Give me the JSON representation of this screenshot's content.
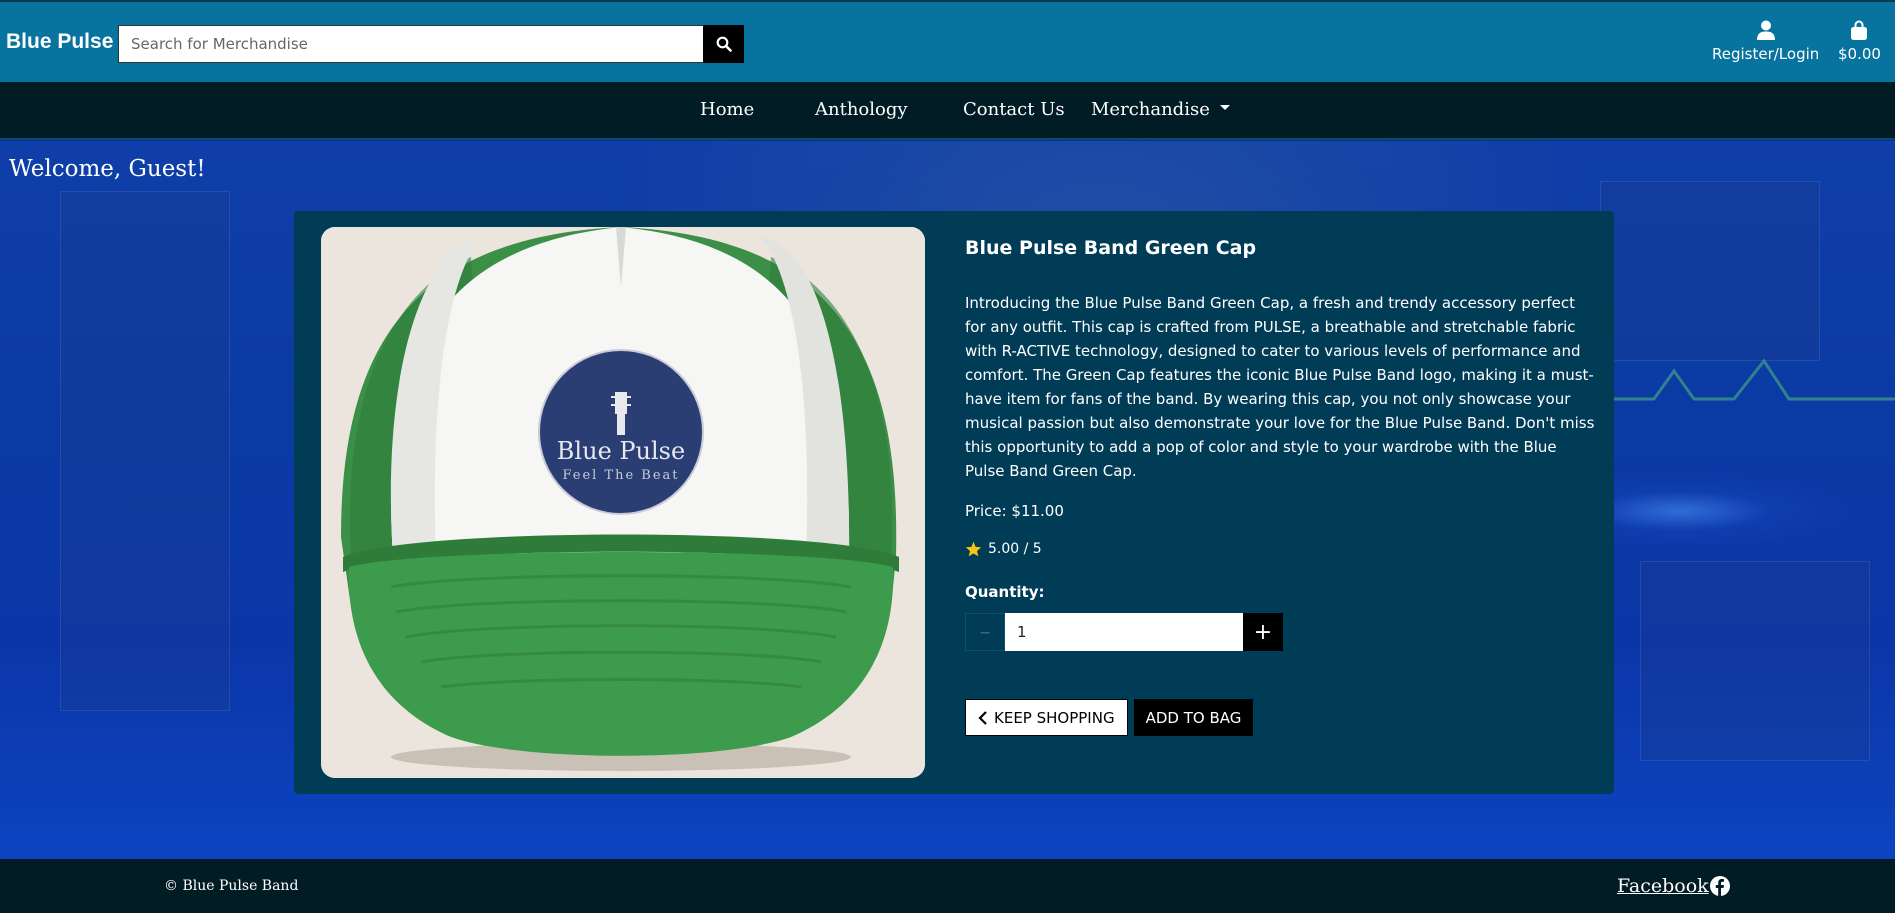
{
  "header": {
    "brand": "Blue Pulse",
    "search": {
      "placeholder": "Search for Merchandise",
      "value": ""
    },
    "account_label": "Register/Login",
    "bag_total": "$0.00"
  },
  "nav": {
    "items": [
      "Home",
      "Anthology",
      "Contact Us",
      "Merchandise"
    ]
  },
  "welcome": "Welcome, Guest!",
  "product": {
    "image_text": {
      "brand": "Blue Pulse",
      "tagline": "Feel The Beat"
    },
    "title": "Blue Pulse Band Green Cap",
    "description": "Introducing the Blue Pulse Band Green Cap, a fresh and trendy accessory perfect for any outfit. This cap is crafted from PULSE, a breathable and stretchable fabric with R-ACTIVE technology, designed to cater to various levels of performance and comfort. The Green Cap features the iconic Blue Pulse Band logo, making it a must-have item for fans of the band. By wearing this cap, you not only showcase your musical passion but also demonstrate your love for the Blue Pulse Band. Don't miss this opportunity to add a pop of color and style to your wardrobe with the Blue Pulse Band Green Cap.",
    "price": "Price: $11.00",
    "rating": "5.00 / 5",
    "quantity_label": "Quantity:",
    "quantity": "1",
    "keep_shopping": "KEEP SHOPPING",
    "add_to_bag": "ADD TO BAG"
  },
  "footer": {
    "copyright": "© Blue Pulse Band",
    "facebook": "Facebook"
  },
  "colors": {
    "header_bg": "#08739f",
    "nav_bg": "#021c25",
    "card_bg": "#013c57",
    "cap_green": "#3c9b4c",
    "logo_navy": "#2a3e73"
  }
}
